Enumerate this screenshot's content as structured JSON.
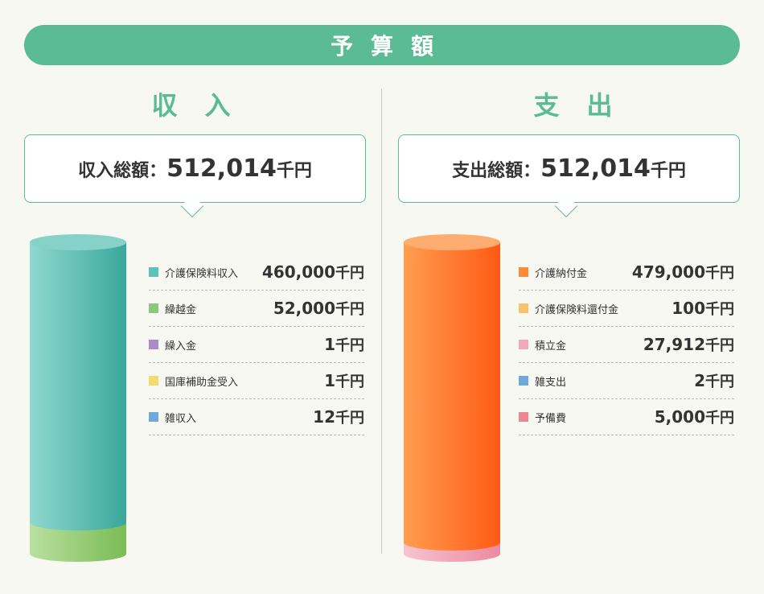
{
  "banner": {
    "title": "予算額"
  },
  "colors": {
    "banner": "#5bbb94",
    "income_cylinder": "#5ec2b7",
    "income_cylinder_base": "#a6d689",
    "expense_cylinder": "#ff8a3a",
    "expense_cylinder_base": "#f3a9ba"
  },
  "income": {
    "heading": "収入",
    "total_label": "収入総額：",
    "total_value": "512,014",
    "total_unit": "千円",
    "items": [
      {
        "label": "介護保険料収入",
        "value": "460,000",
        "unit": "千円",
        "color": "#5ec2b7"
      },
      {
        "label": "繰越金",
        "value": "52,000",
        "unit": "千円",
        "color": "#8cc97a"
      },
      {
        "label": "繰入金",
        "value": "1",
        "unit": "千円",
        "color": "#a98bc9"
      },
      {
        "label": "国庫補助金受入",
        "value": "1",
        "unit": "千円",
        "color": "#f3dc6b"
      },
      {
        "label": "雑収入",
        "value": "12",
        "unit": "千円",
        "color": "#6ea9dc"
      }
    ]
  },
  "expense": {
    "heading": "支出",
    "total_label": "支出総額：",
    "total_value": "512,014",
    "total_unit": "千円",
    "items": [
      {
        "label": "介護納付金",
        "value": "479,000",
        "unit": "千円",
        "color": "#ff8a3a"
      },
      {
        "label": "介護保険料還付金",
        "value": "100",
        "unit": "千円",
        "color": "#f8c36a"
      },
      {
        "label": "積立金",
        "value": "27,912",
        "unit": "千円",
        "color": "#f3a9ba"
      },
      {
        "label": "雑支出",
        "value": "2",
        "unit": "千円",
        "color": "#6ea9dc"
      },
      {
        "label": "予備費",
        "value": "5,000",
        "unit": "千円",
        "color": "#ee8593"
      }
    ]
  },
  "chart_data": [
    {
      "type": "bar",
      "title": "収入",
      "categories": [
        "介護保険料収入",
        "繰越金",
        "繰入金",
        "国庫補助金受入",
        "雑収入"
      ],
      "values": [
        460000,
        52000,
        1,
        1,
        12
      ],
      "unit": "千円",
      "total": 512014
    },
    {
      "type": "bar",
      "title": "支出",
      "categories": [
        "介護納付金",
        "介護保険料還付金",
        "積立金",
        "雑支出",
        "予備費"
      ],
      "values": [
        479000,
        100,
        27912,
        2,
        5000
      ],
      "unit": "千円",
      "total": 512014
    }
  ]
}
